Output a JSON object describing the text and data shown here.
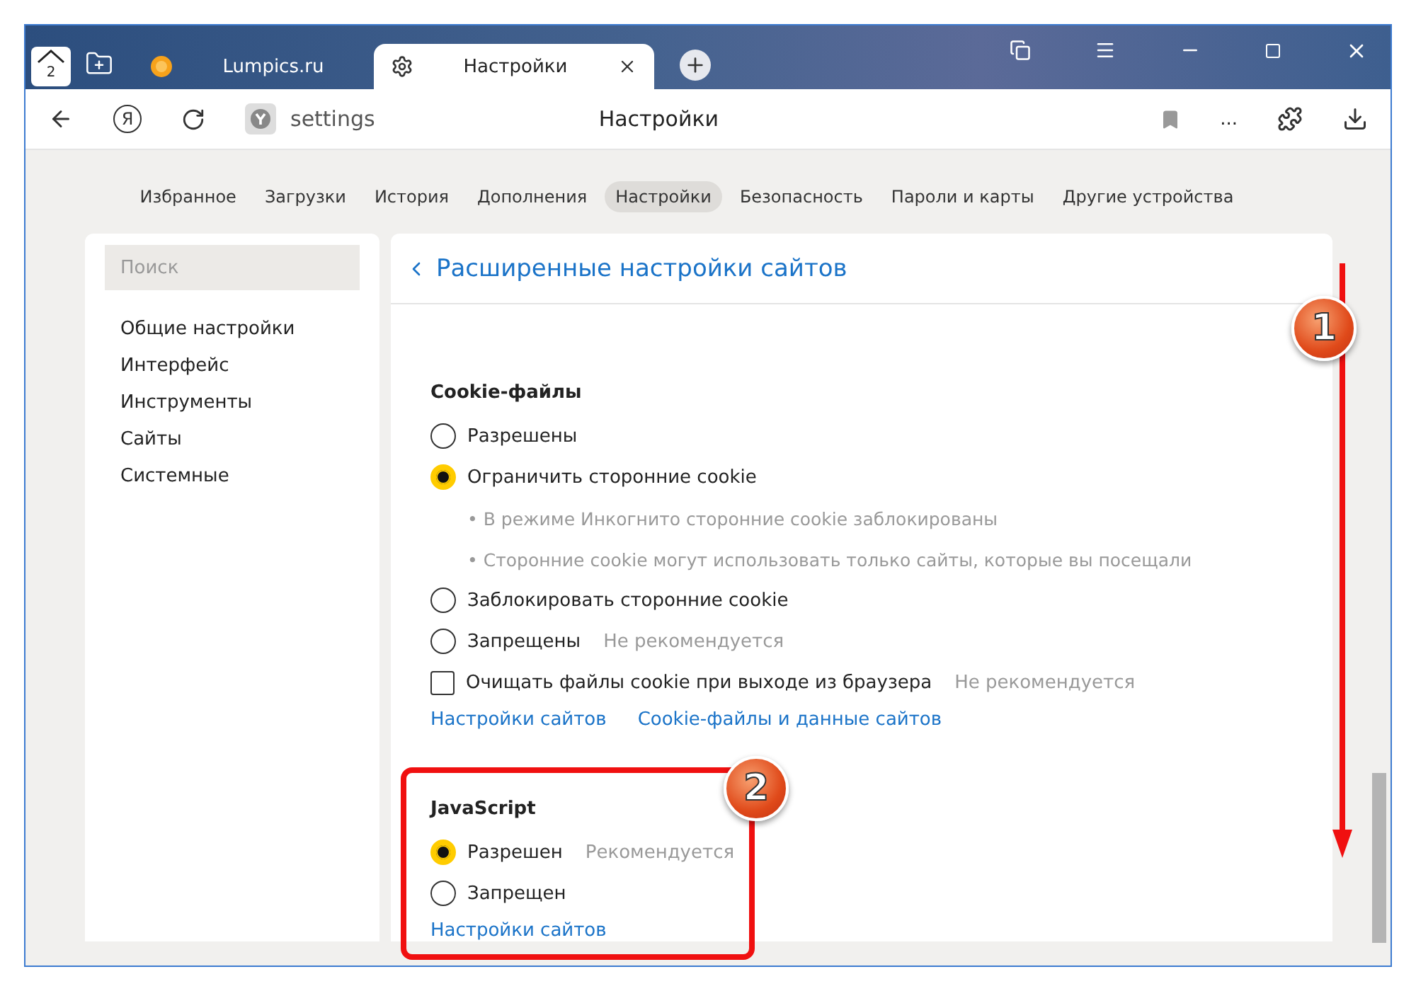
{
  "tabs_bar": {
    "home_count": "2"
  },
  "tabs": [
    {
      "title": "Lumpics.ru",
      "selected": false
    },
    {
      "title": "Настройки",
      "selected": true
    }
  ],
  "address_bar": {
    "yandex_button": "Я",
    "url": "settings",
    "page_title": "Настройки",
    "more_button": "..."
  },
  "nav": [
    {
      "label": "Избранное",
      "selected": false
    },
    {
      "label": "Загрузки",
      "selected": false
    },
    {
      "label": "История",
      "selected": false
    },
    {
      "label": "Дополнения",
      "selected": false
    },
    {
      "label": "Настройки",
      "selected": true
    },
    {
      "label": "Безопасность",
      "selected": false
    },
    {
      "label": "Пароли и карты",
      "selected": false
    },
    {
      "label": "Другие устройства",
      "selected": false
    }
  ],
  "sidebar": {
    "search_placeholder": "Поиск",
    "items": [
      "Общие настройки",
      "Интерфейс",
      "Инструменты",
      "Сайты",
      "Системные"
    ]
  },
  "panel": {
    "title": "Расширенные настройки сайтов",
    "sections": [
      {
        "title": "Cookie-файлы",
        "highlighted": false,
        "options": [
          {
            "kind": "radio",
            "label": "Разрешены",
            "selected": false
          },
          {
            "kind": "radio",
            "label": "Ограничить сторонние cookie",
            "selected": true,
            "bullets": [
              "• В режиме Инкогнито сторонние cookie заблокированы",
              "• Сторонние cookie могут использовать только сайты, которые вы посещали"
            ]
          },
          {
            "kind": "radio",
            "label": "Заблокировать сторонние cookie",
            "selected": false
          },
          {
            "kind": "radio",
            "label": "Запрещены",
            "note": "Не рекомендуется",
            "selected": false
          },
          {
            "kind": "checkbox",
            "label": "Очищать файлы cookie при выходе из браузера",
            "note": "Не рекомендуется",
            "checked": false
          }
        ],
        "links": [
          "Настройки сайтов",
          "Cookie-файлы и данные сайтов"
        ]
      },
      {
        "title": "JavaScript",
        "highlighted": true,
        "badge": "2",
        "options": [
          {
            "kind": "radio",
            "label": "Разрешен",
            "note": "Рекомендуется",
            "selected": true
          },
          {
            "kind": "radio",
            "label": "Запрещен",
            "selected": false
          }
        ],
        "links": [
          "Настройки сайтов"
        ]
      }
    ]
  },
  "scroll_annotation": {
    "badge": "1"
  }
}
